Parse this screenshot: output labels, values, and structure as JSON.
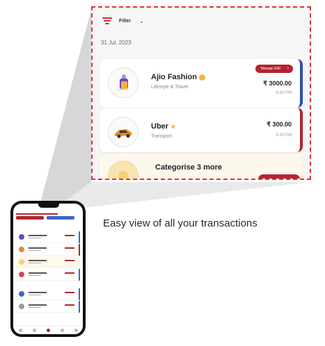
{
  "zoom_panel": {
    "filter_label": "Filter",
    "date": "31 Jul, 2023",
    "transactions": [
      {
        "merchant": "Ajio Fashion",
        "category": "Lifestyle & Travel",
        "amount": "₹ 3000.00",
        "time": "6:20 PM",
        "action_label": "Manage EMI",
        "accent_color": "#2a4fb0"
      },
      {
        "merchant": "Uber",
        "category": "Transport",
        "amount": "₹ 300.00",
        "time": "6:20 PM",
        "accent_color": "#b3242f"
      }
    ],
    "categorise_prompt": "Categorise 3 more"
  },
  "caption": "Easy view of all your transactions",
  "colors": {
    "brand_red": "#b3242f",
    "highlight_dash": "#e0303a",
    "accent_blue": "#2a4fb0"
  },
  "icons": {
    "filter": "filter-lines-icon",
    "chevron": "chevron-down-icon",
    "bag": "shopping-bag-icon",
    "car": "car-icon"
  }
}
